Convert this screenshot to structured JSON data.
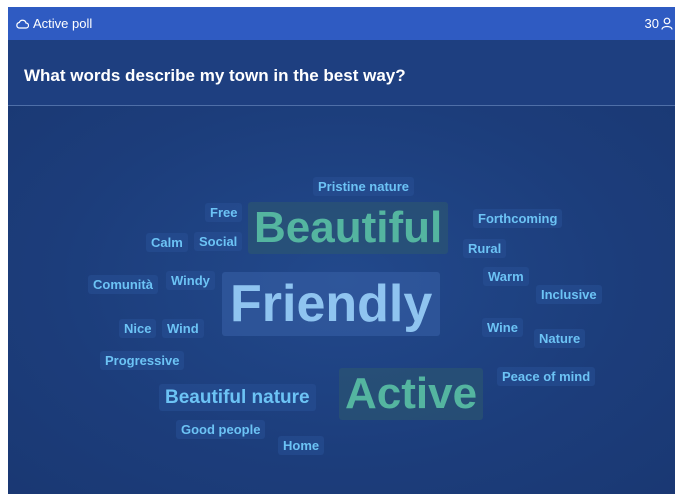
{
  "header": {
    "status": "Active poll",
    "participants": "30"
  },
  "question": "What words describe my town in the best way?",
  "cloud": {
    "words": {
      "pristine_nature": "Pristine nature",
      "free": "Free",
      "beautiful": "Beautiful",
      "forthcoming": "Forthcoming",
      "calm": "Calm",
      "social": "Social",
      "rural": "Rural",
      "comunita": "Comunità",
      "windy": "Windy",
      "friendly": "Friendly",
      "warm": "Warm",
      "inclusive": "Inclusive",
      "nice": "Nice",
      "wind": "Wind",
      "wine": "Wine",
      "nature": "Nature",
      "progressive": "Progressive",
      "peace_of_mind": "Peace of mind",
      "beautiful_nature": "Beautiful nature",
      "active": "Active",
      "good_people": "Good people",
      "home": "Home"
    }
  }
}
